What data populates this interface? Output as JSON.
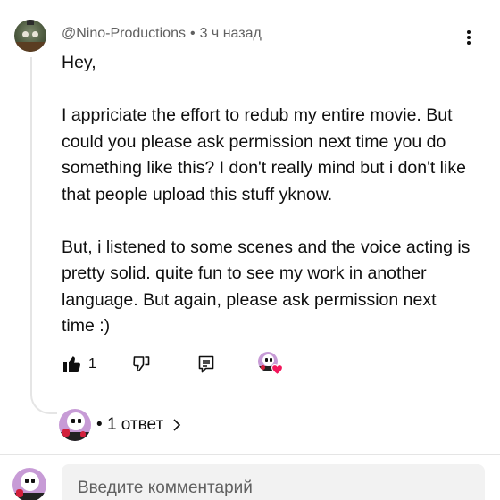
{
  "comment": {
    "author": "@Nino-Productions",
    "separator": "•",
    "time": "3 ч назад",
    "text": "Hey,\n\nI appriciate the effort to redub my entire movie. But could you please ask permission next time you do something like this? I don't really mind but i don't like that people upload this stuff yknow.\n\nBut, i listened to some scenes and the voice acting is pretty solid. quite fun to see my work in another language. But again, please ask permission next time :)",
    "like_count": "1"
  },
  "replies": {
    "bullet": "•",
    "label": "1 ответ"
  },
  "input": {
    "placeholder": "Введите комментарий"
  },
  "colors": {
    "heart": "#f2155b",
    "avatar_purple": "#c79bd6",
    "secondary_text": "#606060"
  },
  "icons": [
    "kebab-icon",
    "thumb-up-icon",
    "thumb-down-icon",
    "reply-icon",
    "heart-icon",
    "chevron-right-icon"
  ]
}
